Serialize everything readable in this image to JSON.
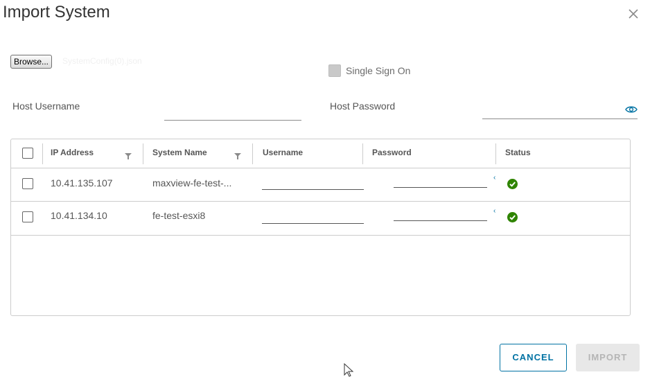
{
  "dialog": {
    "title": "Import System",
    "close_icon": "close-icon"
  },
  "file": {
    "browse_label": "Browse...",
    "file_name": "SystemConfig(0).json"
  },
  "sso": {
    "label": "Single Sign On",
    "checked": false
  },
  "host": {
    "username_label": "Host Username",
    "username_value": "",
    "password_label": "Host Password",
    "password_value": "",
    "reveal_icon": "eye-icon"
  },
  "table": {
    "columns": [
      "IP Address",
      "System Name",
      "Username",
      "Password",
      "Status"
    ],
    "rows": [
      {
        "ip": "10.41.135.107",
        "system_name": "maxview-fe-test-...",
        "username": "",
        "password": "",
        "status": "ok"
      },
      {
        "ip": "10.41.134.10",
        "system_name": "fe-test-esxi8",
        "username": "",
        "password": "",
        "status": "ok"
      }
    ]
  },
  "actions": {
    "cancel_label": "CANCEL",
    "import_label": "IMPORT"
  },
  "colors": {
    "accent": "#0072a3",
    "success": "#2f8400",
    "disabled_bg": "#e8e8e8"
  }
}
